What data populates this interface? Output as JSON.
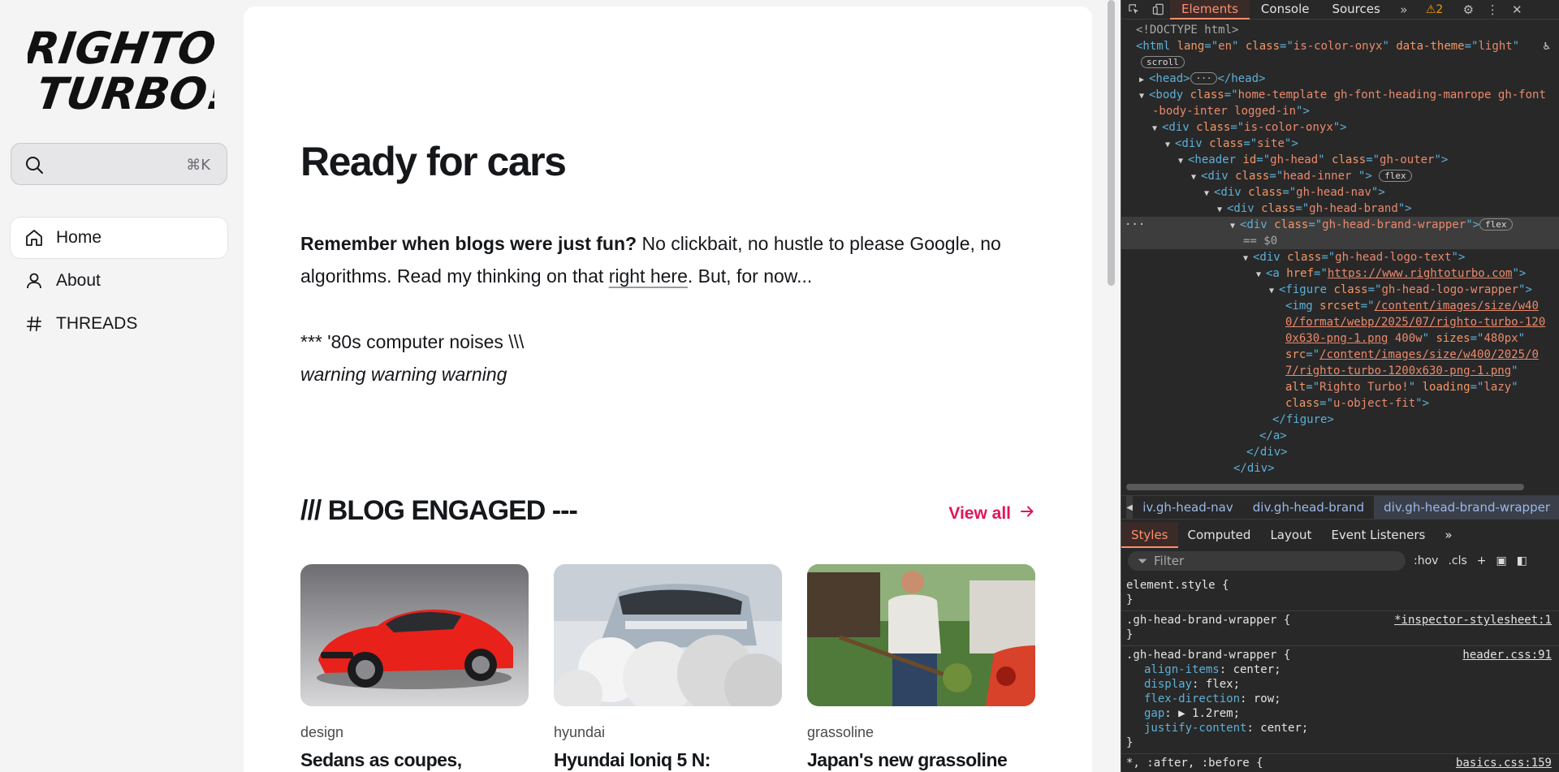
{
  "sidebar": {
    "logo_text": "RIGHTO TURBO!",
    "search": {
      "shortcut": "⌘K"
    },
    "nav": [
      {
        "label": "Home",
        "icon": "home-icon",
        "active": true
      },
      {
        "label": "About",
        "icon": "user-icon",
        "active": false
      },
      {
        "label": "THREADS",
        "icon": "hash-icon",
        "active": false
      }
    ]
  },
  "main": {
    "hero_title": "Ready for cars",
    "intro_bold": "Remember when blogs were just fun?",
    "intro_text_1": " No clickbait, no hustle to please Google, no algorithms. Read my thinking on that ",
    "intro_link": "right here",
    "intro_text_2": ". But, for now...",
    "noise_line": "*** '80s computer noises \\\\\\",
    "noise_italic": "warning warning warning",
    "section_title": "/// BLOG ENGAGED ---",
    "view_all": "View all",
    "cards": [
      {
        "tag": "design",
        "title": "Sedans as coupes,",
        "image": "red-sports-sedan"
      },
      {
        "tag": "hyundai",
        "title": "Hyundai Ioniq 5 N:",
        "image": "car-smoke-burnout"
      },
      {
        "tag": "grassoline",
        "title": "Japan's new grassoline",
        "image": "man-shoveling-grass"
      }
    ]
  },
  "devtools": {
    "tabs": [
      "Elements",
      "Console",
      "Sources"
    ],
    "active_tab": "Elements",
    "warning_count": "2",
    "dom": {
      "doctype": "<!DOCTYPE html>",
      "html_lang": "en",
      "html_class": "is-color-onyx",
      "html_theme": "light",
      "scroll_badge": "scroll",
      "body_class_1": "home-template gh-font-heading-manrope gh-font",
      "body_class_2": "-body-inter logged-in",
      "div_color": "is-color-onyx",
      "div_site": "site",
      "header_id": "gh-head",
      "header_class": "gh-outer",
      "head_inner": "head-inner ",
      "flex_badge": "flex",
      "head_nav": "gh-head-nav",
      "head_brand": "gh-head-brand",
      "brand_wrapper": "gh-head-brand-wrapper",
      "eq_marker": "== $0",
      "logo_text": "gh-head-logo-text",
      "href": "https://www.rightoturbo.com",
      "figure_class": "gh-head-logo-wrapper",
      "srcset_1": "/content/images/size/w40",
      "srcset_2": "0/format/webp/2025/07/righto-turbo-120",
      "srcset_3": "0x630-png-1.png",
      "srcset_w": " 400w",
      "sizes": "480px",
      "src_1": "/content/images/size/w400/2025/0",
      "src_2": "7/righto-turbo-1200x630-png-1.png",
      "alt": "Righto Turbo!",
      "loading": "lazy",
      "img_class": "u-object-fit"
    },
    "breadcrumbs": [
      "iv.gh-head-nav",
      "div.gh-head-brand",
      "div.gh-head-brand-wrapper"
    ],
    "styles_tabs": [
      "Styles",
      "Computed",
      "Layout",
      "Event Listeners"
    ],
    "filter_placeholder": "Filter",
    "filter_tools": [
      ":hov",
      ".cls"
    ],
    "rules": {
      "element_style": "element.style {",
      "inspector_sel": ".gh-head-brand-wrapper {",
      "inspector_src": "*inspector-stylesheet:1",
      "header_sel": ".gh-head-brand-wrapper {",
      "header_src": "header.css:91",
      "props": [
        {
          "name": "align-items",
          "value": "center;"
        },
        {
          "name": "display",
          "value": "flex;"
        },
        {
          "name": "flex-direction",
          "value": "row;"
        },
        {
          "name": "gap",
          "value": "▶ 1.2rem;"
        },
        {
          "name": "justify-content",
          "value": "center;"
        }
      ],
      "last_sel": "*, :after, :before {",
      "last_src": "basics.css:159"
    }
  }
}
